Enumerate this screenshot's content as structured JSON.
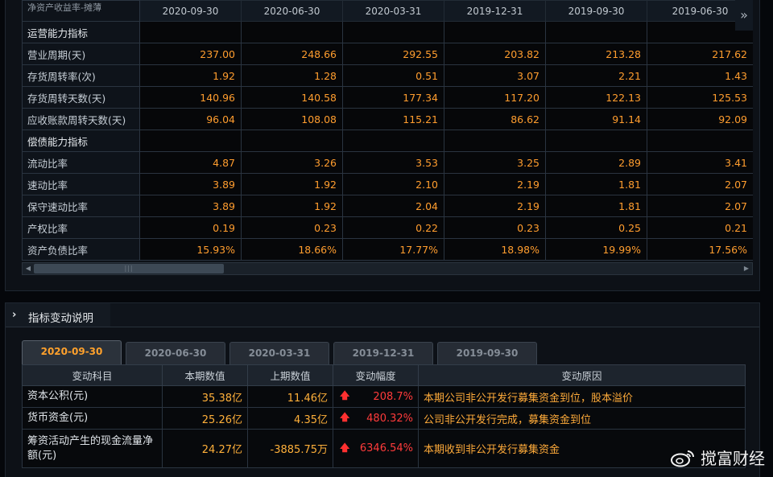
{
  "top_table": {
    "header_label": "净资产收益率-摊薄",
    "dates": [
      "2020-09-30",
      "2020-06-30",
      "2020-03-31",
      "2019-12-31",
      "2019-09-30",
      "2019-06-30"
    ],
    "rows": [
      {
        "label": "运营能力指标",
        "section": true,
        "values": [
          "",
          "",
          "",
          "",
          "",
          ""
        ]
      },
      {
        "label": "营业周期(天)",
        "section": false,
        "values": [
          "237.00",
          "248.66",
          "292.55",
          "203.82",
          "213.28",
          "217.62"
        ]
      },
      {
        "label": "存货周转率(次)",
        "section": false,
        "values": [
          "1.92",
          "1.28",
          "0.51",
          "3.07",
          "2.21",
          "1.43"
        ]
      },
      {
        "label": "存货周转天数(天)",
        "section": false,
        "values": [
          "140.96",
          "140.58",
          "177.34",
          "117.20",
          "122.13",
          "125.53"
        ]
      },
      {
        "label": "应收账款周转天数(天)",
        "section": false,
        "values": [
          "96.04",
          "108.08",
          "115.21",
          "86.62",
          "91.14",
          "92.09"
        ]
      },
      {
        "label": "偿债能力指标",
        "section": true,
        "values": [
          "",
          "",
          "",
          "",
          "",
          ""
        ]
      },
      {
        "label": "流动比率",
        "section": false,
        "values": [
          "4.87",
          "3.26",
          "3.53",
          "3.25",
          "2.89",
          "3.41"
        ]
      },
      {
        "label": "速动比率",
        "section": false,
        "values": [
          "3.89",
          "1.92",
          "2.10",
          "2.19",
          "1.81",
          "2.07"
        ]
      },
      {
        "label": "保守速动比率",
        "section": false,
        "values": [
          "3.89",
          "1.92",
          "2.04",
          "2.19",
          "1.81",
          "2.07"
        ]
      },
      {
        "label": "产权比率",
        "section": false,
        "values": [
          "0.19",
          "0.23",
          "0.22",
          "0.23",
          "0.25",
          "0.21"
        ]
      },
      {
        "label": "资产负债比率",
        "section": false,
        "values": [
          "15.93%",
          "18.66%",
          "17.77%",
          "18.98%",
          "19.99%",
          "17.56%"
        ]
      }
    ],
    "more_icon": "double-chevron-right-icon"
  },
  "change_section": {
    "title": "指标变动说明",
    "tabs": [
      "2020-09-30",
      "2020-06-30",
      "2020-03-31",
      "2019-12-31",
      "2019-09-30"
    ],
    "active_tab": 0,
    "columns": [
      "变动科目",
      "本期数值",
      "上期数值",
      "变动幅度",
      "变动原因"
    ],
    "rows": [
      {
        "item": "资本公积(元)",
        "current": "35.38亿",
        "previous": "11.46亿",
        "change": "208.7%",
        "reason": "本期公司非公开发行募集资金到位，股本溢价"
      },
      {
        "item": "货币资金(元)",
        "current": "25.26亿",
        "previous": "4.35亿",
        "change": "480.32%",
        "reason": "公司非公开发行完成，募集资金到位"
      },
      {
        "item": "筹资活动产生的现金流量净额(元)",
        "current": "24.27亿",
        "previous": "-3885.75万",
        "change": "6346.54%",
        "reason": "本期收到非公开发行募集资金"
      }
    ],
    "up_arrow_icon": "up-arrow-icon"
  },
  "watermark": {
    "text": "搅富财经",
    "icon": "weibo-icon"
  },
  "colors": {
    "value_orange": "#ff9d2e",
    "active_tab": "#ffa12c",
    "up_red": "#ff3b3b"
  }
}
